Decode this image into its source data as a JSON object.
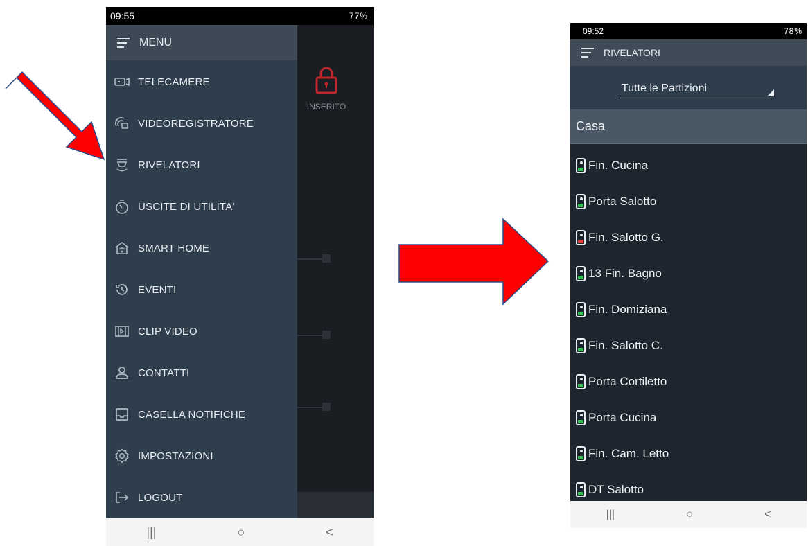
{
  "left_phone": {
    "status_time": "09:55",
    "status_right": "77%",
    "drawer_title": "MENU",
    "background_status": "INSERITO",
    "menu": [
      {
        "label": "TELECAMERE",
        "icon": "camera-icon"
      },
      {
        "label": "VIDEOREGISTRATORE",
        "icon": "video-recorder-icon"
      },
      {
        "label": "RIVELATORI",
        "icon": "detector-icon"
      },
      {
        "label": "USCITE DI UTILITA'",
        "icon": "timer-icon"
      },
      {
        "label": "SMART HOME",
        "icon": "smart-home-icon"
      },
      {
        "label": "EVENTI",
        "icon": "history-icon"
      },
      {
        "label": "CLIP VIDEO",
        "icon": "film-icon"
      },
      {
        "label": "CONTATTI",
        "icon": "person-icon"
      },
      {
        "label": "CASELLA NOTIFICHE",
        "icon": "inbox-icon"
      },
      {
        "label": "IMPOSTAZIONI",
        "icon": "gear-icon"
      },
      {
        "label": "LOGOUT",
        "icon": "logout-icon"
      }
    ]
  },
  "right_phone": {
    "status_time": "09:52",
    "status_right": "78%",
    "title": "RIVELATORI",
    "partition": "Tutte le Partizioni",
    "section": "Casa",
    "detectors": [
      {
        "name": "Fin. Cucina",
        "state_color": "#3bbf5a"
      },
      {
        "name": "Porta Salotto",
        "state_color": "#3bbf5a"
      },
      {
        "name": "Fin. Salotto G.",
        "state_color": "#e0393e"
      },
      {
        "name": "13 Fin. Bagno",
        "state_color": "#3bbf5a"
      },
      {
        "name": "Fin. Domiziana",
        "state_color": "#3bbf5a"
      },
      {
        "name": "Fin. Salotto C.",
        "state_color": "#3bbf5a"
      },
      {
        "name": "Porta Cortiletto",
        "state_color": "#3bbf5a"
      },
      {
        "name": "Porta Cucina",
        "state_color": "#3bbf5a"
      },
      {
        "name": "Fin. Cam. Letto",
        "state_color": "#3bbf5a"
      },
      {
        "name": "DT Salotto",
        "state_color": "#3bbf5a"
      }
    ]
  },
  "nav": {
    "recents": "|||",
    "home": "○",
    "back": "<"
  },
  "colors": {
    "arrow": "#ff0000",
    "accent_red": "#c0262d"
  }
}
